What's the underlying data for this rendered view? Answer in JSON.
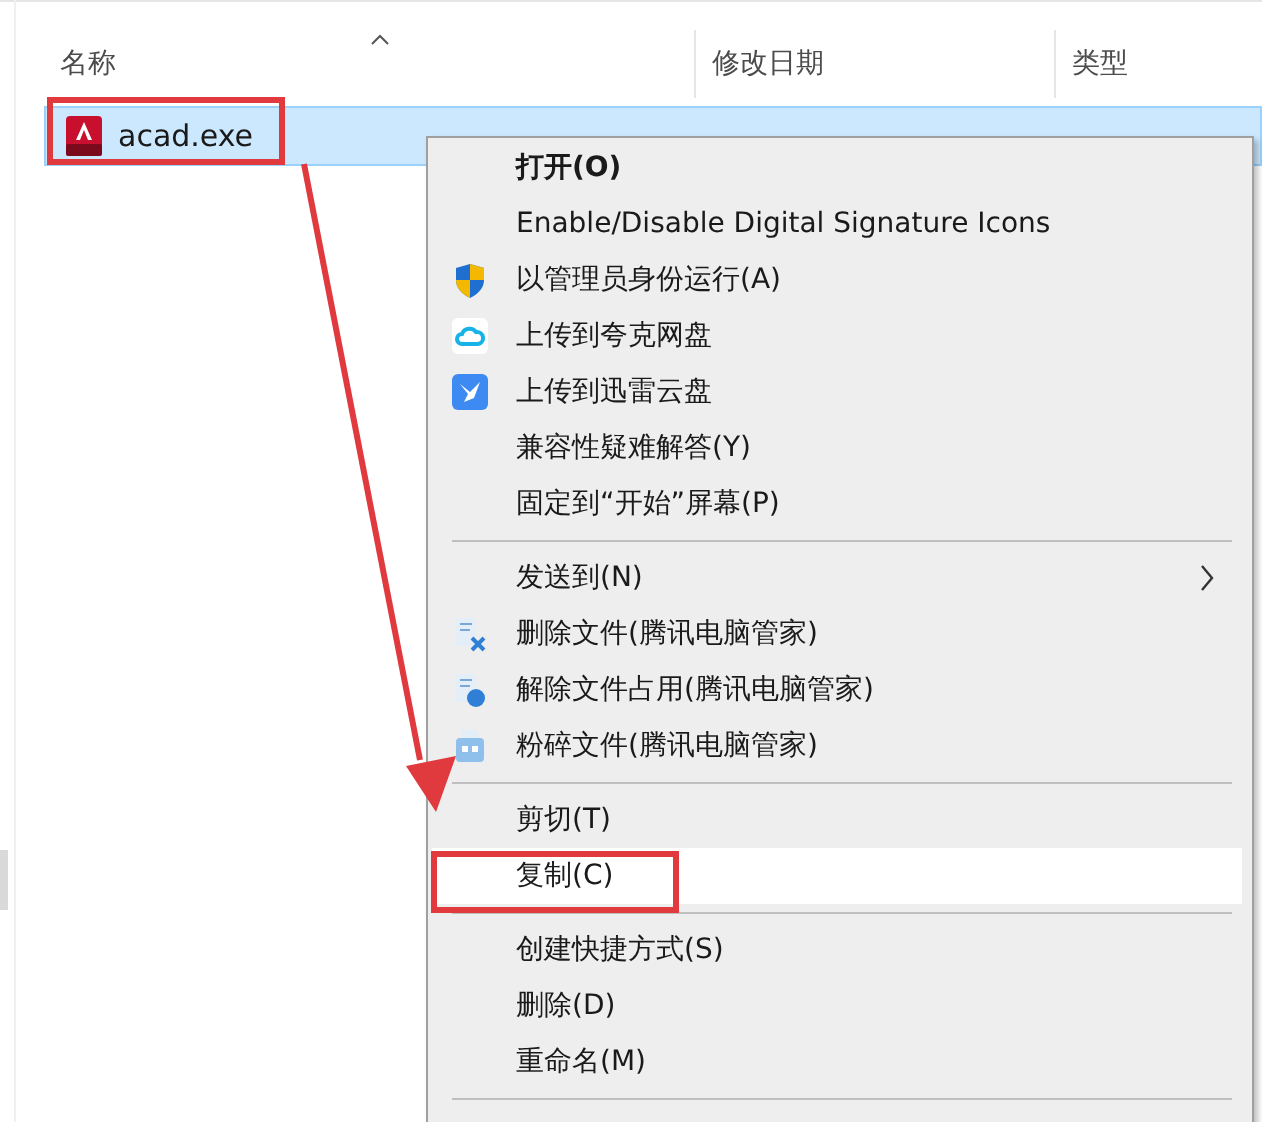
{
  "columns": [
    {
      "label": "名称",
      "sorted": true
    },
    {
      "label": "修改日期",
      "sorted": false
    },
    {
      "label": "类型",
      "sorted": false
    }
  ],
  "files": [
    {
      "name": "acad.exe",
      "selected": true
    }
  ],
  "context_menu": {
    "items": [
      {
        "kind": "text",
        "label": "打开(O)",
        "default": true,
        "selected": false
      },
      {
        "kind": "text",
        "label": "Enable/Disable Digital Signature Icons",
        "default": false,
        "selected": false
      },
      {
        "kind": "shield",
        "label": "以管理员身份运行(A)",
        "default": false,
        "selected": false
      },
      {
        "kind": "cloud",
        "label": "上传到夸克网盘",
        "default": false,
        "selected": false
      },
      {
        "kind": "bird",
        "label": "上传到迅雷云盘",
        "default": false,
        "selected": false
      },
      {
        "kind": "text",
        "label": "兼容性疑难解答(Y)",
        "default": false,
        "selected": false
      },
      {
        "kind": "text",
        "label": "固定到“开始”屏幕(P)",
        "default": false,
        "selected": false
      },
      {
        "kind": "separator"
      },
      {
        "kind": "submenu",
        "label": "发送到(N)",
        "default": false,
        "selected": false
      },
      {
        "kind": "filedelete",
        "label": "删除文件(腾讯电脑管家)",
        "default": false,
        "selected": false
      },
      {
        "kind": "fileunlock",
        "label": "解除文件占用(腾讯电脑管家)",
        "default": false,
        "selected": false
      },
      {
        "kind": "shredder",
        "label": "粉碎文件(腾讯电脑管家)",
        "default": false,
        "selected": false
      },
      {
        "kind": "separator"
      },
      {
        "kind": "text",
        "label": "剪切(T)",
        "default": false,
        "selected": false
      },
      {
        "kind": "text",
        "label": "复制(C)",
        "default": false,
        "selected": true
      },
      {
        "kind": "separator"
      },
      {
        "kind": "text",
        "label": "创建快捷方式(S)",
        "default": false,
        "selected": false
      },
      {
        "kind": "text",
        "label": "删除(D)",
        "default": false,
        "selected": false
      },
      {
        "kind": "text",
        "label": "重命名(M)",
        "default": false,
        "selected": false
      },
      {
        "kind": "separator"
      }
    ]
  }
}
